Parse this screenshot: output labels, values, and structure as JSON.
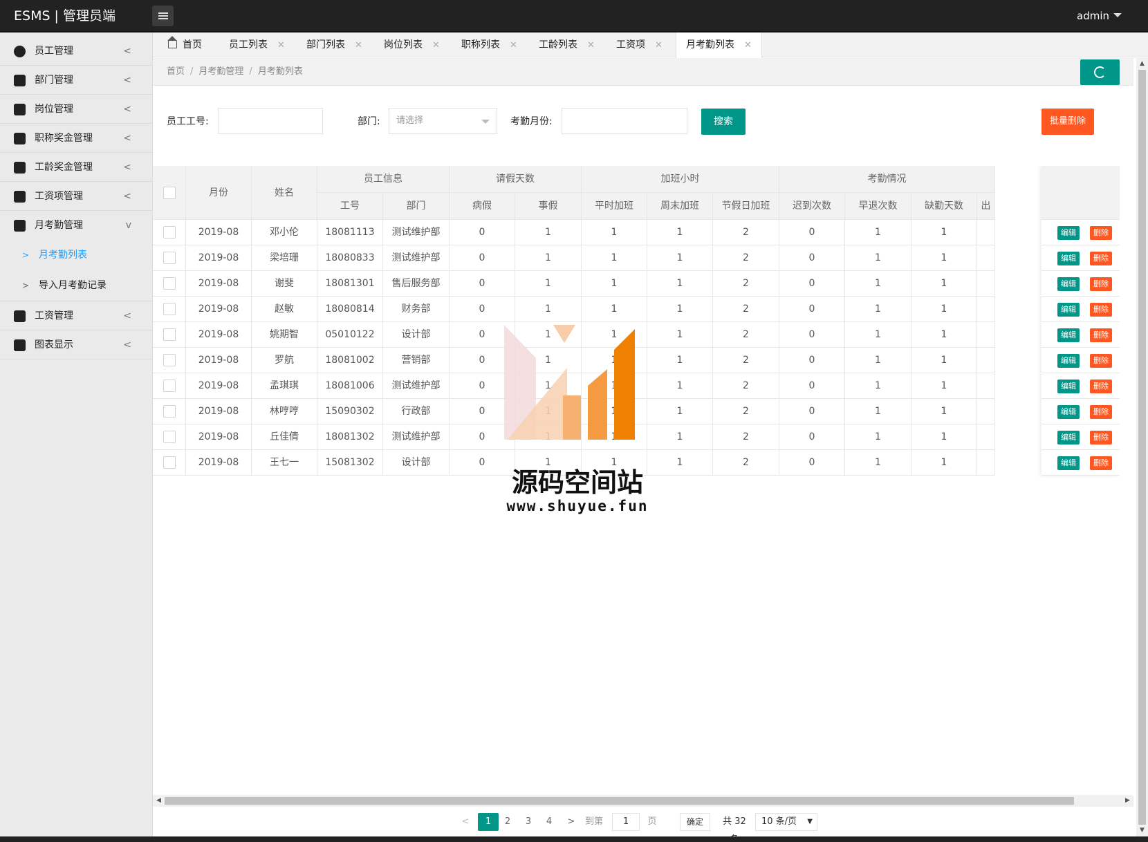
{
  "header": {
    "logo": "ESMS | 管理员端",
    "user": "admin"
  },
  "sidebar": {
    "items": [
      {
        "label": "员工管理",
        "icon": "users-icon",
        "arrow": "<"
      },
      {
        "label": "部门管理",
        "icon": "sitemap-icon",
        "arrow": "<"
      },
      {
        "label": "岗位管理",
        "icon": "badge-icon",
        "arrow": "<"
      },
      {
        "label": "职称奖金管理",
        "icon": "briefcase-icon",
        "arrow": "<"
      },
      {
        "label": "工龄奖金管理",
        "icon": "cash-register-icon",
        "arrow": "<"
      },
      {
        "label": "工资项管理",
        "icon": "window-icon",
        "arrow": "<"
      },
      {
        "label": "月考勤管理",
        "icon": "layers-icon",
        "arrow": "v"
      },
      {
        "label": "工资管理",
        "icon": "tag-icon",
        "arrow": "<"
      },
      {
        "label": "图表显示",
        "icon": "receipt-icon",
        "arrow": "<"
      }
    ],
    "sub_items": [
      {
        "label": "月考勤列表",
        "marker": ">"
      },
      {
        "label": "导入月考勤记录",
        "marker": ">"
      }
    ]
  },
  "tabs": [
    "首页",
    "员工列表",
    "部门列表",
    "岗位列表",
    "职称列表",
    "工龄列表",
    "工资项",
    "月考勤列表"
  ],
  "tab_close": "✕",
  "breadcrumb": [
    "首页",
    "月考勤管理",
    "月考勤列表"
  ],
  "breadcrumb_sep": "/",
  "search": {
    "emp_no_label": "员工工号:",
    "dept_label": "部门:",
    "dept_placeholder": "请选择",
    "month_label": "考勤月份:",
    "search_button": "搜索",
    "batch_delete_button": "批量删除"
  },
  "table": {
    "groups": [
      "员工信息",
      "请假天数",
      "加班小时",
      "考勤情况"
    ],
    "columns": [
      "月份",
      "姓名",
      "工号",
      "部门",
      "病假",
      "事假",
      "平时加班",
      "周末加班",
      "节假日加班",
      "迟到次数",
      "早退次数",
      "缺勤天数",
      "出"
    ],
    "rows": [
      [
        "2019-08",
        "邓小伦",
        "18081113",
        "测试维护部",
        "0",
        "1",
        "1",
        "1",
        "2",
        "0",
        "1",
        "1"
      ],
      [
        "2019-08",
        "梁培珊",
        "18080833",
        "测试维护部",
        "0",
        "1",
        "1",
        "1",
        "2",
        "0",
        "1",
        "1"
      ],
      [
        "2019-08",
        "谢斐",
        "18081301",
        "售后服务部",
        "0",
        "1",
        "1",
        "1",
        "2",
        "0",
        "1",
        "1"
      ],
      [
        "2019-08",
        "赵敏",
        "18080814",
        "财务部",
        "0",
        "1",
        "1",
        "1",
        "2",
        "0",
        "1",
        "1"
      ],
      [
        "2019-08",
        "姚期智",
        "05010122",
        "设计部",
        "0",
        "1",
        "1",
        "1",
        "2",
        "0",
        "1",
        "1"
      ],
      [
        "2019-08",
        "罗航",
        "18081002",
        "营销部",
        "0",
        "1",
        "1",
        "1",
        "2",
        "0",
        "1",
        "1"
      ],
      [
        "2019-08",
        "孟琪琪",
        "18081006",
        "测试维护部",
        "0",
        "1",
        "1",
        "1",
        "2",
        "0",
        "1",
        "1"
      ],
      [
        "2019-08",
        "林哼哼",
        "15090302",
        "行政部",
        "0",
        "1",
        "1",
        "1",
        "2",
        "0",
        "1",
        "1"
      ],
      [
        "2019-08",
        "丘佳倩",
        "18081302",
        "测试维护部",
        "0",
        "1",
        "1",
        "1",
        "2",
        "0",
        "1",
        "1"
      ],
      [
        "2019-08",
        "王七一",
        "15081302",
        "设计部",
        "0",
        "1",
        "1",
        "1",
        "2",
        "0",
        "1",
        "1"
      ]
    ],
    "edit_label": "编辑",
    "delete_label": "删除"
  },
  "pagination": {
    "prev": "<",
    "next": ">",
    "pages": [
      "1",
      "2",
      "3",
      "4"
    ],
    "current": "1",
    "goto_label": "到第",
    "goto_value": "1",
    "page_unit": "页",
    "confirm": "确定",
    "total": "共 32 条",
    "page_size": "10 条/页"
  },
  "watermark": {
    "text": "源码空间站",
    "url": "www.shuyue.fun"
  },
  "colors": {
    "primary": "#009688",
    "danger": "#ff5722",
    "active_link": "#1e9fff",
    "header_bg": "#222222"
  }
}
